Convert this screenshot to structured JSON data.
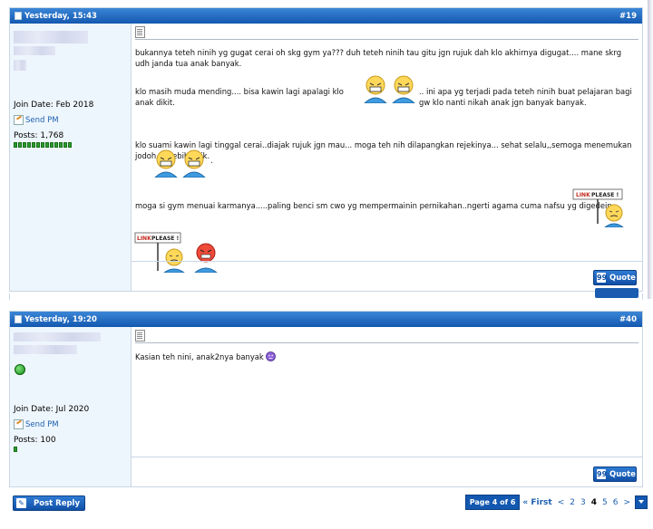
{
  "posts": [
    {
      "date": "Yesterday, 15:43",
      "number": "#19",
      "user": {
        "join_date": "Join Date: Feb 2018",
        "send_pm": "Send PM",
        "posts": "Posts: 1,768",
        "reputation_bars": 13
      },
      "paragraphs": [
        "bukannya teteh ninih yg gugat cerai oh skg gym ya??? duh teteh ninih tau gitu jgn rujuk dah klo akhirnya digugat.... mane skrg udh janda tua anak banyak.",
        "klo masih muda mending.... bisa kawin lagi apalagi klo anak dikit.",
        ".. ini apa yg terjadi pada teteh ninih buat pelajaran bagi gw klo nanti nikah anak jgn banyak banyak.",
        "klo suami kawin lagi tinggal cerai..diajak rujuk jgn mau... moga teh nih dilapangkan rejekinya... sehat selalu,,semoga menemukan jodoh yg lebih baik.",
        ".",
        "moga si gym menuai karmanya.....paling benci sm cwo yg mempermainin pernikahan..ngerti agama cuma nafsu yg digedein.."
      ],
      "sign_text": "LINK PLEASE !",
      "quote": "Quote"
    },
    {
      "date": "Yesterday, 19:20",
      "number": "#40",
      "user": {
        "join_date": "Join Date: Jul 2020",
        "send_pm": "Send PM",
        "posts": "Posts: 100",
        "reputation_bars": 1
      },
      "paragraphs": [
        "Kasian teh nini, anak2nya banyak"
      ],
      "quote": "Quote"
    }
  ],
  "footer": {
    "post_reply": "Post Reply",
    "pager": {
      "label": "Page 4 of 6",
      "first": "« First",
      "prev": "<",
      "pages": [
        "2",
        "3",
        "4",
        "5",
        "6"
      ],
      "current": "4",
      "next": ">"
    }
  },
  "colors": {
    "header_blue": "#1358b0",
    "user_bg": "#eef6fd",
    "rep_green": "#2f9b2f"
  },
  "icons": [
    "post-icon",
    "doc-icon",
    "send-pm-icon",
    "quote-icon",
    "post-reply-icon",
    "online-status-icon",
    "sad-smiley-icon",
    "chevron-down-icon"
  ]
}
